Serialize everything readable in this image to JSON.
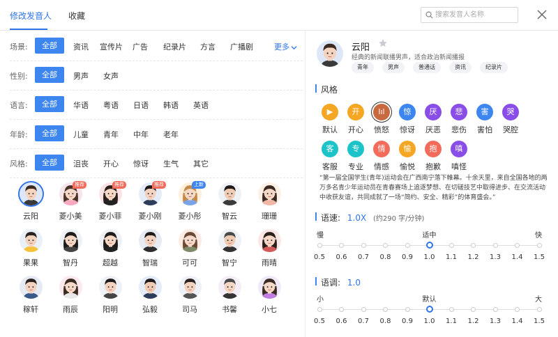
{
  "tabs": [
    {
      "label": "修改发音人",
      "active": true
    },
    {
      "label": "收藏",
      "active": false
    }
  ],
  "search": {
    "placeholder": "搜索发音人名称"
  },
  "filters": {
    "scene": {
      "label": "场景:",
      "options": [
        "全部",
        "资讯",
        "宣传片",
        "广告",
        "纪录片",
        "方言",
        "广播剧"
      ],
      "more": "更多"
    },
    "gender": {
      "label": "性别:",
      "options": [
        "全部",
        "男声",
        "女声"
      ]
    },
    "language": {
      "label": "语言:",
      "options": [
        "全部",
        "华语",
        "粤语",
        "日语",
        "韩语",
        "英语"
      ]
    },
    "age": {
      "label": "年龄:",
      "options": [
        "全部",
        "儿童",
        "青年",
        "中年",
        "老年"
      ]
    },
    "style": {
      "label": "风格:",
      "options": [
        "全部",
        "沮丧",
        "开心",
        "惊讶",
        "生气",
        "其它"
      ]
    }
  },
  "voices": [
    {
      "name": "云阳",
      "badge": "",
      "current": true
    },
    {
      "name": "菱小美",
      "badge": "推荐"
    },
    {
      "name": "菱小菲",
      "badge": "推荐"
    },
    {
      "name": "菱小刚",
      "badge": "推荐"
    },
    {
      "name": "菱小彤",
      "badge": "上新"
    },
    {
      "name": "智云",
      "badge": ""
    },
    {
      "name": "珊珊",
      "badge": ""
    },
    {
      "name": "果果",
      "badge": ""
    },
    {
      "name": "智丹",
      "badge": ""
    },
    {
      "name": "超越",
      "badge": ""
    },
    {
      "name": "智瑞",
      "badge": ""
    },
    {
      "name": "可可",
      "badge": ""
    },
    {
      "name": "智宁",
      "badge": ""
    },
    {
      "name": "雨晴",
      "badge": ""
    },
    {
      "name": "稼轩",
      "badge": ""
    },
    {
      "name": "雨辰",
      "badge": ""
    },
    {
      "name": "阳明",
      "badge": ""
    },
    {
      "name": "弘毅",
      "badge": ""
    },
    {
      "name": "司马",
      "badge": ""
    },
    {
      "name": "书馨",
      "badge": ""
    },
    {
      "name": "小七",
      "badge": ""
    }
  ],
  "badge_colors": {
    "推荐": "#f26b5b",
    "上新": "#3d86f0"
  },
  "preview": {
    "name": "云阳",
    "desc": "经典的新闻联播男声，适合政治新闻播报",
    "tags": [
      "青年",
      "男声",
      "普通话",
      "资讯",
      "纪录片"
    ]
  },
  "style_section": {
    "title": "风格",
    "items": [
      {
        "char": "▶",
        "label": "默认",
        "color": "#f5a623"
      },
      {
        "char": "开",
        "label": "开心",
        "color": "#f5a623"
      },
      {
        "char": "lıl",
        "label": "愤怒",
        "color": "#e8734a",
        "current": true
      },
      {
        "char": "惊",
        "label": "惊讶",
        "color": "#3d86f0"
      },
      {
        "char": "厌",
        "label": "厌恶",
        "color": "#8a4ee8"
      },
      {
        "char": "悲",
        "label": "悲伤",
        "color": "#8a4ee8"
      },
      {
        "char": "害",
        "label": "害怕",
        "color": "#3d86f0"
      },
      {
        "char": "哭",
        "label": "哭腔",
        "color": "#8a4ee8"
      },
      {
        "char": "客",
        "label": "客服",
        "color": "#1cc4c9"
      },
      {
        "char": "专",
        "label": "专业",
        "color": "#1cc4c9"
      },
      {
        "char": "情",
        "label": "情感",
        "color": "#f26b5b"
      },
      {
        "char": "愉",
        "label": "愉悦",
        "color": "#f5a623"
      },
      {
        "char": "抱",
        "label": "抱歉",
        "color": "#f26b5b"
      },
      {
        "char": "嗔",
        "label": "嗔怪",
        "color": "#8a4ee8"
      }
    ]
  },
  "sample_text": "“第一届全国学生(青年)运动会在广西南宁落下帷幕。十余天里，来自全国各地的两万多名青少年运动员在青春赛场上追逐梦想、在切磋技艺中取得进步、在交流活动中收获友谊，共同成就了一场“简约、安全、精彩”的体育盛会。”",
  "speed": {
    "title": "语速:",
    "value": "1.0X",
    "sub": "(约290 字/分钟)",
    "left": "慢",
    "mid": "适中",
    "right": "快",
    "ticks": [
      "0.5",
      "0.6",
      "0.7",
      "0.8",
      "0.9",
      "1.0",
      "1.1",
      "1.2",
      "1.3",
      "1.4",
      "1.5"
    ],
    "selected": 5
  },
  "tone": {
    "title": "语调:",
    "value": "1.0",
    "left": "小",
    "mid": "默认",
    "right": "大",
    "ticks": [
      "0.5",
      "0.6",
      "0.7",
      "0.8",
      "0.9",
      "1.0",
      "1.1",
      "1.2",
      "1.3",
      "1.4",
      "1.5"
    ],
    "selected": 5
  },
  "colors": {
    "accent": "#2f74e8",
    "selected_bg": "#3d86f0"
  }
}
